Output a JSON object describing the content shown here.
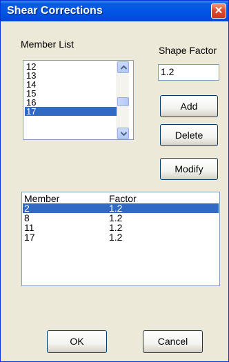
{
  "window": {
    "title": "Shear Corrections",
    "close_symbol": "✕"
  },
  "member_list": {
    "label": "Member List",
    "items": [
      "12",
      "13",
      "14",
      "15",
      "16",
      "17"
    ],
    "selected": "17"
  },
  "shape_factor": {
    "label": "Shape Factor",
    "value": "1.2"
  },
  "buttons": {
    "add": "Add",
    "delete": "Delete",
    "modify": "Modify",
    "ok": "OK",
    "cancel": "Cancel"
  },
  "table": {
    "headers": [
      "Member",
      "Factor"
    ],
    "rows": [
      {
        "member": "2",
        "factor": "1.2",
        "selected": true
      },
      {
        "member": "8",
        "factor": "1.2",
        "selected": false
      },
      {
        "member": "11",
        "factor": "1.2",
        "selected": false
      },
      {
        "member": "17",
        "factor": "1.2",
        "selected": false
      }
    ]
  },
  "colors": {
    "title_bar": "#0055e5",
    "selection": "#316ac5",
    "dialog_bg": "#ece9d8",
    "close_button": "#e2492b"
  }
}
